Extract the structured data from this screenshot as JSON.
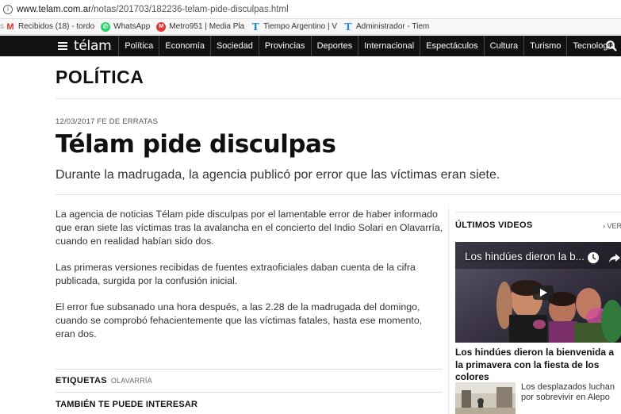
{
  "browser": {
    "url_domain": "www.telam.com.ar",
    "url_path": "/notas/201703/182236-telam-pide-disculpas.html",
    "bookmarks": [
      {
        "label": "Recibidos (18) - tordo",
        "icon": "gmail-icon"
      },
      {
        "label": "WhatsApp",
        "icon": "whatsapp-icon"
      },
      {
        "label": "Metro951 | Media Pla",
        "icon": "metro-icon"
      },
      {
        "label": "Tiempo Argentino | V",
        "icon": "tiempo-icon"
      },
      {
        "label": "Administrador - Tiem",
        "icon": "tiempo-icon"
      }
    ]
  },
  "nav": {
    "logo": "télam",
    "items": [
      "Política",
      "Economía",
      "Sociedad",
      "Provincias",
      "Deportes",
      "Internacional",
      "Espectáculos",
      "Cultura",
      "Turismo",
      "Tecnología"
    ]
  },
  "section": "POLÍTICA",
  "article": {
    "meta": "12/03/2017 FE DE ERRATAS",
    "title": "Télam pide disculpas",
    "subtitle": "Durante la madrugada, la agencia publicó por error que las víctimas eran siete.",
    "paragraphs": [
      "La agencia de noticias Télam pide disculpas por el lamentable error de haber informado que eran siete las víctimas tras la avalancha en el concierto del Indio Solari en Olavarría, cuando en realidad habían sido dos.",
      "Las primeras versiones recibidas de fuentes extraoficiales daban cuenta de la cifra publicada, surgida por la confusión inicial.",
      "El error fue subsanado una hora después, a las 2.28 de la madrugada del domingo, cuando se comprobó fehacientemente que las víctimas fatales, hasta ese momento, eran dos."
    ],
    "tags_label": "ETIQUETAS",
    "tag": "OLAVARRÍA",
    "related_label": "TAMBIÉN TE PUEDE INTERESAR"
  },
  "sidebar": {
    "heading": "ÚLTIMOS VIDEOS",
    "more": "› VER",
    "video_title": "Los hindúes dieron la b...",
    "video_caption": "Los hindúes dieron la bienvenida a la primavera con la fiesta de los colores",
    "related_text": "Los desplazados luchan por sobrevivir en Alepo"
  }
}
